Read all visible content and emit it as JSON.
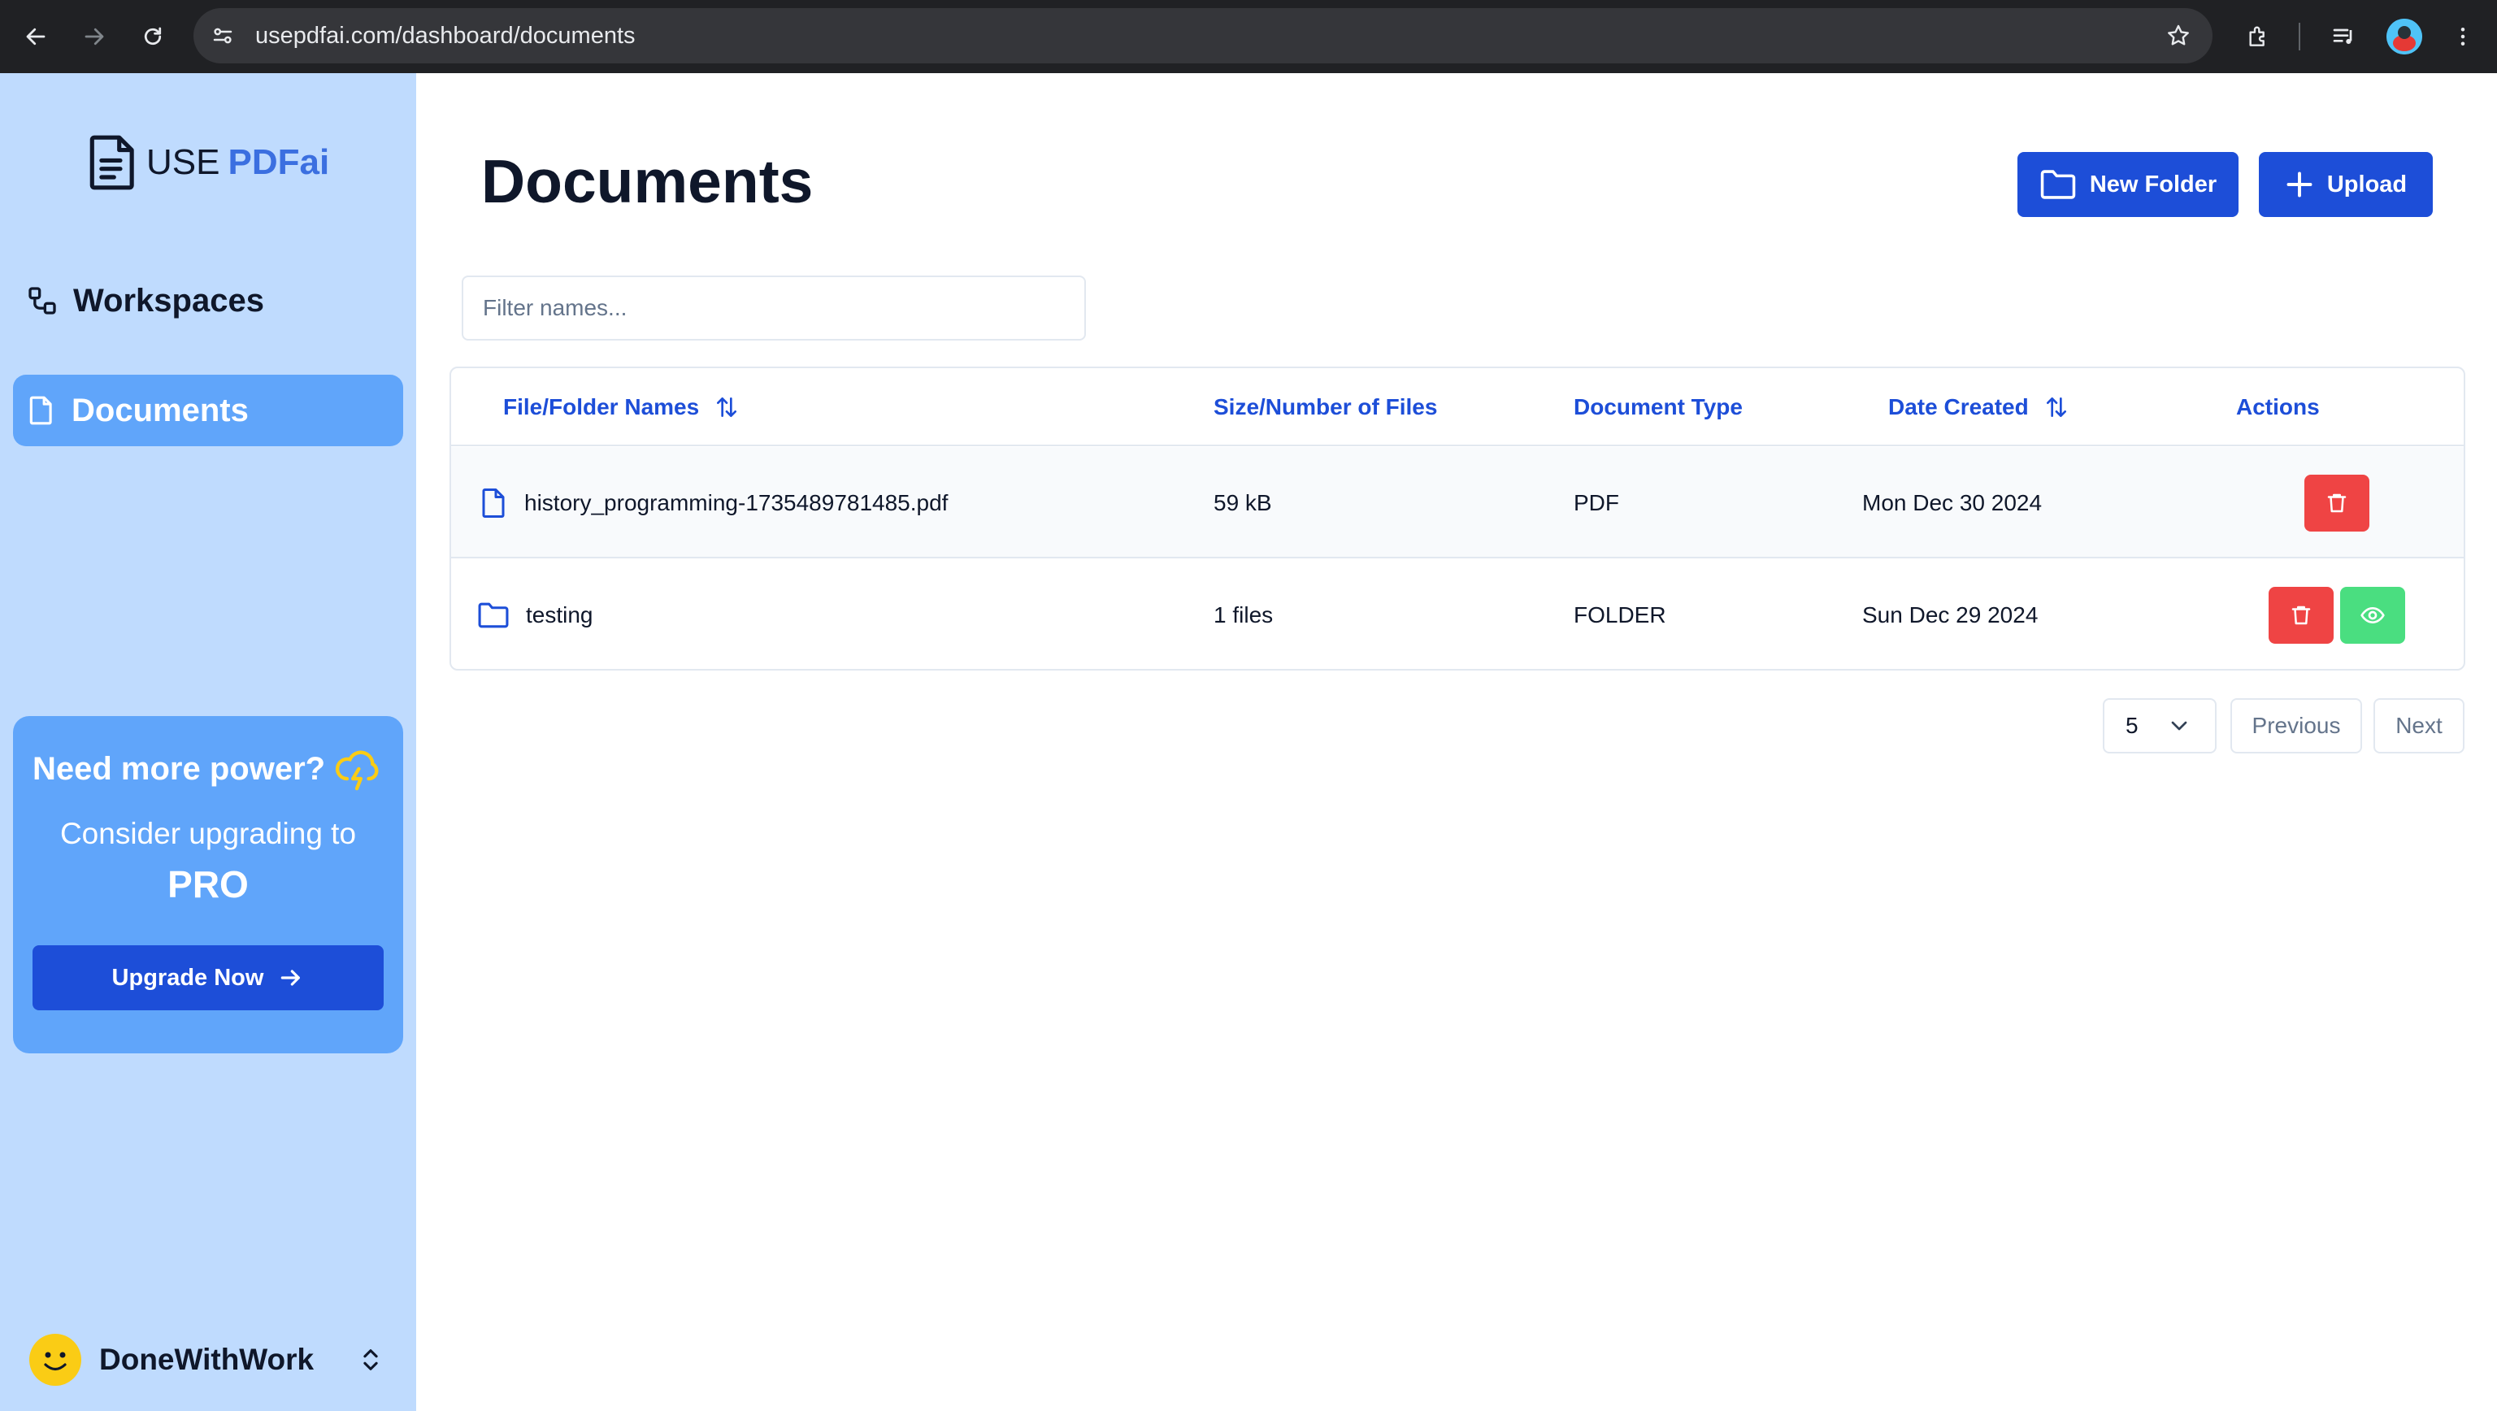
{
  "browser": {
    "url": "usepdfai.com/dashboard/documents"
  },
  "sidebar": {
    "logo": {
      "prefix": "USE",
      "brand": "PDFai"
    },
    "items": [
      {
        "label": "Workspaces",
        "icon": "workspaces-icon",
        "active": false
      },
      {
        "label": "Documents",
        "icon": "document-icon",
        "active": true
      }
    ],
    "promo": {
      "heading": "Need more power?",
      "subtitle": "Consider upgrading to",
      "plan": "PRO",
      "button_label": "Upgrade Now"
    },
    "user": {
      "name": "DoneWithWork"
    }
  },
  "main": {
    "title": "Documents",
    "new_folder_label": "New Folder",
    "upload_label": "Upload",
    "filter_placeholder": "Filter names...",
    "table": {
      "columns": [
        "File/Folder Names",
        "Size/Number of Files",
        "Document Type",
        "Date Created",
        "Actions"
      ],
      "rows": [
        {
          "name": "history_programming-1735489781485.pdf",
          "size": "59 kB",
          "type": "PDF",
          "date": "Mon Dec 30 2024",
          "kind": "file"
        },
        {
          "name": "testing",
          "size": "1 files",
          "type": "FOLDER",
          "date": "Sun Dec 29 2024",
          "kind": "folder"
        }
      ]
    },
    "pagination": {
      "page_size": "5",
      "previous_label": "Previous",
      "next_label": "Next"
    }
  },
  "colors": {
    "sidebar_bg": "#bfdbfe",
    "accent": "#1d4ed8",
    "active_item": "#60a5fa",
    "delete": "#ef4444",
    "view": "#4ade80"
  }
}
